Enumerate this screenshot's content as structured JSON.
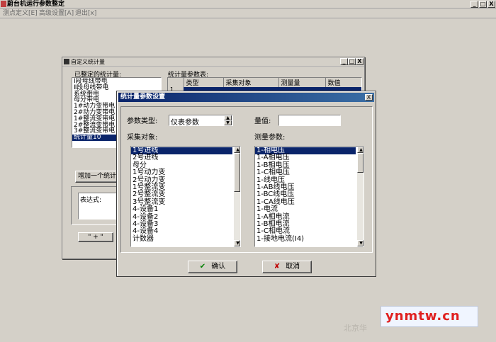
{
  "app": {
    "title": "蔚台机运行参数整定",
    "menu": [
      "测点定义[E]",
      "高级设置[A]",
      "退出[x]"
    ],
    "controls": [
      "_",
      "□",
      "X"
    ]
  },
  "window1": {
    "title": "自定义统计量",
    "controls": [
      "_",
      "□",
      "X"
    ],
    "defined_label": "已整定的统计量:",
    "defined_items": [
      "Ⅰ段母线带电",
      "Ⅱ段母线带电",
      "系统带电",
      "母分带电",
      "1#动力变带电",
      "2#动力变带电",
      "1#整流变带电",
      "2#整流变带电",
      "3#整流变带电",
      "统计量10"
    ],
    "defined_selected_index": 9,
    "params_table_label": "统计量参数表:",
    "params_columns": [
      "类型",
      "采集对象",
      "测量量",
      "数值"
    ],
    "row_number": "1",
    "add_button": "增加一个统计",
    "expr_label": "表达式:",
    "plus_button": "\" + \""
  },
  "dialog": {
    "title": "统计量参数设置",
    "close": "X",
    "param_type_label": "参数类型:",
    "param_type_value": "仪表参数",
    "value_label": "量值:",
    "value_field": "",
    "collect_label": "采集对象:",
    "collect_items": [
      "1号进线",
      "2号进线",
      "母分",
      "1号动力变",
      "2号动力变",
      "1号整流变",
      "2号整流变",
      "3号整流变",
      "4-设备1",
      "4-设备2",
      "4-设备3",
      "4-设备4",
      "计数器"
    ],
    "collect_selected_index": 0,
    "measure_label": "测量参数:",
    "measure_items": [
      "1-相电压",
      "1-A相电压",
      "1-B相电压",
      "1-C相电压",
      "1-线电压",
      "1-AB线电压",
      "1-BC线电压",
      "1-CA线电压",
      "1-电流",
      "1-A相电流",
      "1-B相电流",
      "1-C相电流",
      "1-接地电流(I4)"
    ],
    "measure_selected_index": 0,
    "ok_button": "确认",
    "cancel_button": "取消"
  },
  "watermark": {
    "brand": "ynmtw.cn",
    "faint_text": "北京华"
  }
}
